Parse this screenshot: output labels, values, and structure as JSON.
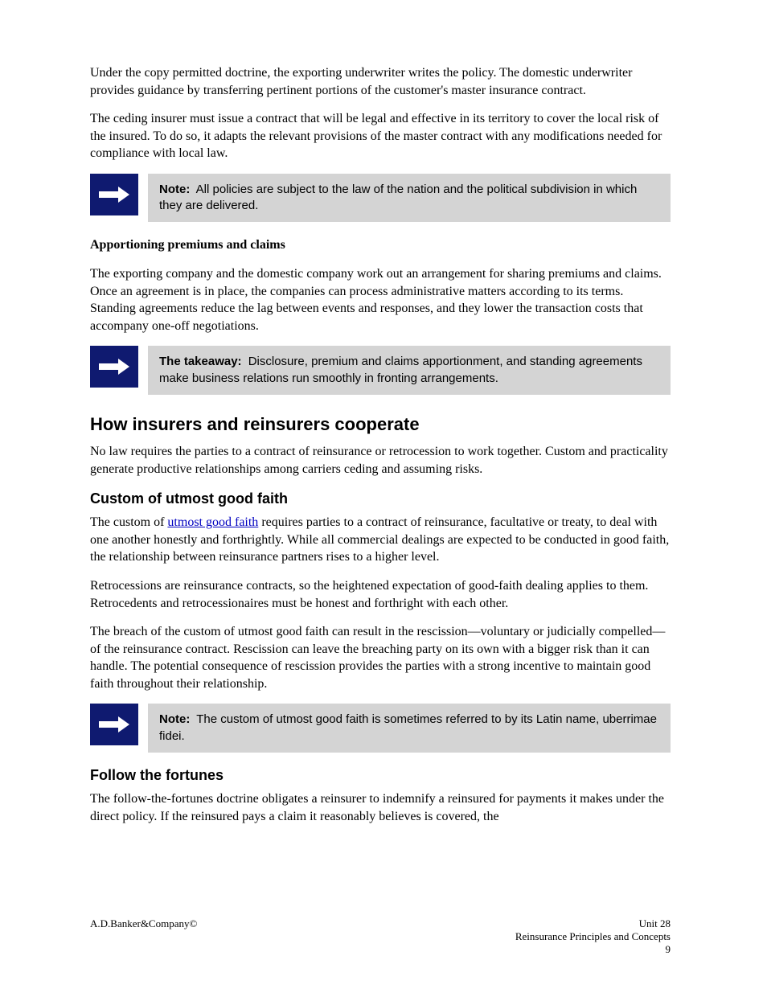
{
  "p1": "Under the copy permitted doctrine, the exporting underwriter writes the policy. The domestic underwriter provides guidance by transferring pertinent portions of the customer's master insurance contract.",
  "p2": "The ceding insurer must issue a contract that will be legal and effective in its territory to cover the local risk of the insured. To do so, it adapts the relevant provisions of the master contract with any modifications needed for compliance with local law.",
  "callout1": {
    "bold": "Note:",
    "text": "All policies are subject to the law of the nation and the political subdivision in which they are delivered."
  },
  "p3": "Apportioning premiums and claims",
  "p4": "The exporting company and the domestic company work out an arrangement for sharing premiums and claims. Once an agreement is in place, the companies can process administrative matters according to its terms. Standing agreements reduce the lag between events and responses, and they lower the transaction costs that accompany one-off negotiations.",
  "callout2": {
    "bold": "The takeaway:",
    "text": "Disclosure, premium and claims apportionment, and standing agreements make business relations run smoothly in fronting arrangements."
  },
  "h_cooperation": "How insurers and reinsurers cooperate",
  "p5": "No law requires the parties to a contract of reinsurance or retrocession to work together. Custom and practicality generate productive relationships among carriers ceding and assuming risks.",
  "h_custom": "Custom of utmost good faith",
  "p6_a": "The custom of ",
  "p6_link": "utmost good faith",
  "p6_b": " requires parties to a contract of reinsurance, facultative or treaty, to deal with one another honestly and forthrightly. While all commercial dealings are expected to be conducted in good faith, the relationship between reinsurance partners rises to a higher level.",
  "p7": "Retrocessions are reinsurance contracts, so the heightened expectation of good-faith dealing applies to them. Retrocedents and retrocessionaires must be honest and forthright with each other.",
  "p8": "The breach of the custom of utmost good faith can result in the rescission—voluntary or judicially compelled—of the reinsurance contract. Rescission can leave the breaching party on its own with a bigger risk than it can handle. The potential consequence of rescission provides the parties with a strong incentive to maintain good faith throughout their relationship.",
  "callout3": {
    "bold": "Note:",
    "text": "The custom of utmost good faith is sometimes referred to by its Latin name, uberrimae fidei."
  },
  "h_follow": "Follow the fortunes",
  "p9": "The follow-the-fortunes doctrine obligates a reinsurer to indemnify a reinsured for payments it makes under the direct policy. If the reinsured pays a claim it reasonably believes is covered, the",
  "footer": {
    "left": "A.D.Banker&Company©",
    "right_line1": "Unit 28",
    "right_line2": "Reinsurance Principles and Concepts",
    "right_line3": "9"
  }
}
